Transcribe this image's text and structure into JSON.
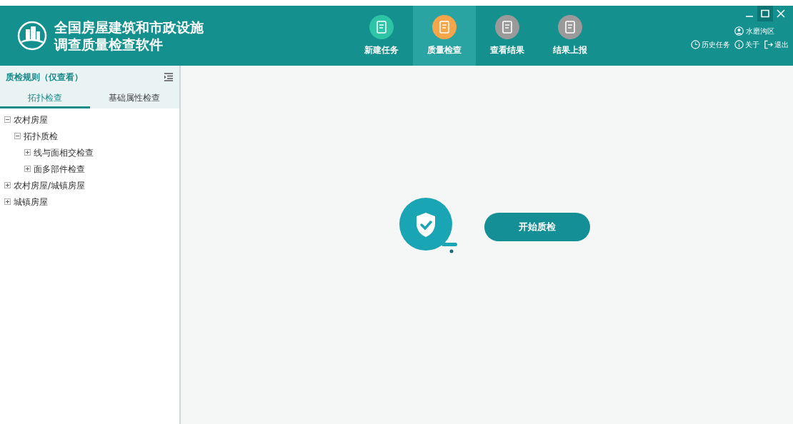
{
  "app": {
    "title_line_1": "全国房屋建筑和市政设施",
    "title_line_2": "调查质量检查软件"
  },
  "nav": [
    {
      "label": "新建任务",
      "selected": false,
      "color": "#2ec4a6"
    },
    {
      "label": "质量检查",
      "selected": true,
      "color": "#f5a54a"
    },
    {
      "label": "查看结果",
      "selected": false,
      "color": "#9a9a9a"
    },
    {
      "label": "结果上报",
      "selected": false,
      "color": "#9a9a9a"
    }
  ],
  "user": {
    "name": "水磨沟区"
  },
  "header_links": [
    {
      "kind": "history",
      "label": "历史任务"
    },
    {
      "kind": "about",
      "label": "关于"
    },
    {
      "kind": "logout",
      "label": "退出"
    }
  ],
  "sidebar": {
    "title": "质检规则（仅查看）",
    "tabs": [
      {
        "label": "拓扑检查",
        "selected": true
      },
      {
        "label": "基础属性检查",
        "selected": false
      }
    ],
    "tree": [
      {
        "label": "农村房屋",
        "expanded": true,
        "children": [
          {
            "label": "拓扑质检",
            "expanded": true,
            "children": [
              {
                "label": "线与面相交检查",
                "expanded": false
              },
              {
                "label": "面多部件检查",
                "expanded": false
              }
            ]
          }
        ]
      },
      {
        "label": "农村房屋/城镇房屋",
        "expanded": false
      },
      {
        "label": "城镇房屋",
        "expanded": false
      }
    ]
  },
  "main": {
    "start_button": "开始质检"
  }
}
